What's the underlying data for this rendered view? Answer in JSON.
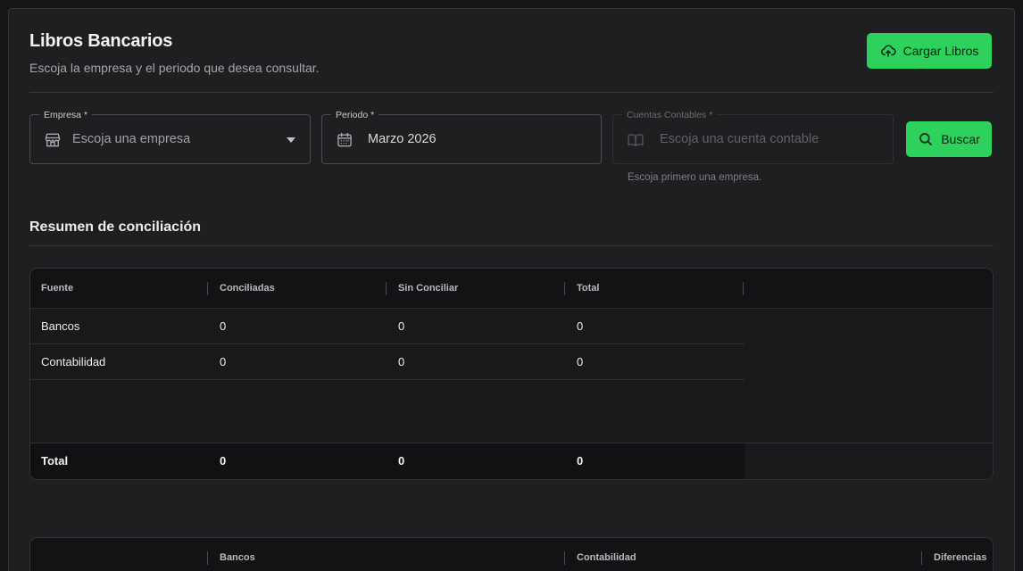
{
  "header": {
    "title": "Libros Bancarios",
    "subtitle": "Escoja la empresa y el periodo que desea consultar.",
    "upload_button": "Cargar Libros"
  },
  "filters": {
    "empresa": {
      "label": "Empresa *",
      "value": "Escoja una empresa",
      "icon": "store-icon"
    },
    "periodo": {
      "label": "Periodo *",
      "value": "Marzo 2026",
      "icon": "calendar-icon"
    },
    "cuentas": {
      "label": "Cuentas Contables *",
      "value": "Escoja una cuenta contable",
      "icon": "book-icon",
      "helper": "Escoja primero una empresa."
    },
    "search_button": "Buscar"
  },
  "summary": {
    "title": "Resumen de conciliación",
    "columns": [
      "Fuente",
      "Conciliadas",
      "Sin Conciliar",
      "Total"
    ],
    "rows": [
      [
        "Bancos",
        "0",
        "0",
        "0"
      ],
      [
        "Contabilidad",
        "0",
        "0",
        "0"
      ]
    ],
    "footer": [
      "Total",
      "0",
      "0",
      "0"
    ]
  },
  "second_table": {
    "columns": [
      "Bancos",
      "Contabilidad",
      "Diferencias"
    ]
  },
  "colors": {
    "accent": "#2fd15d",
    "background": "#1e1f21"
  }
}
